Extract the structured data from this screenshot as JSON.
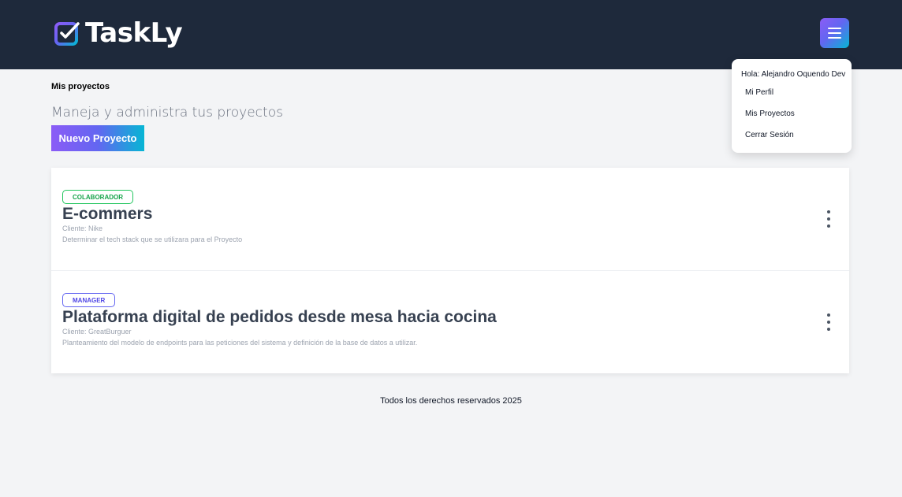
{
  "header": {
    "logo_text": "TaskLy",
    "menu_icon": "hamburger-icon",
    "accent_gradient": [
      "#8b5cf6",
      "#6366f1",
      "#06b6d4"
    ],
    "background": "#1e293b"
  },
  "dropdown": {
    "greeting": "Hola: Alejandro Oquendo Dev",
    "items": [
      {
        "label": "Mi Perfil"
      },
      {
        "label": "Mis Proyectos"
      },
      {
        "label": "Cerrar Sesión"
      }
    ]
  },
  "page": {
    "title": "Mis proyectos",
    "subtitle": "Maneja y administra tus proyectos",
    "new_button": "Nuevo Proyecto"
  },
  "projects": [
    {
      "role": "COLABORADOR",
      "role_color": "#16a34a",
      "name": "E-commers",
      "client": "Cliente: Nike",
      "description": "Determinar el tech stack que se utilizara para el Proyecto",
      "options_icon": "kebab-menu-icon"
    },
    {
      "role": "MANAGER",
      "role_color": "#4f46e5",
      "name": "Plataforma digital de pedidos desde mesa hacia cocina",
      "client": "Cliente: GreatBurguer",
      "description": "Planteamiento del modelo de endpoints para las peticiones del sistema y definición de la base de datos a utilizar.",
      "options_icon": "kebab-menu-icon"
    }
  ],
  "footer": {
    "text": "Todos los derechos reservados 2025"
  }
}
